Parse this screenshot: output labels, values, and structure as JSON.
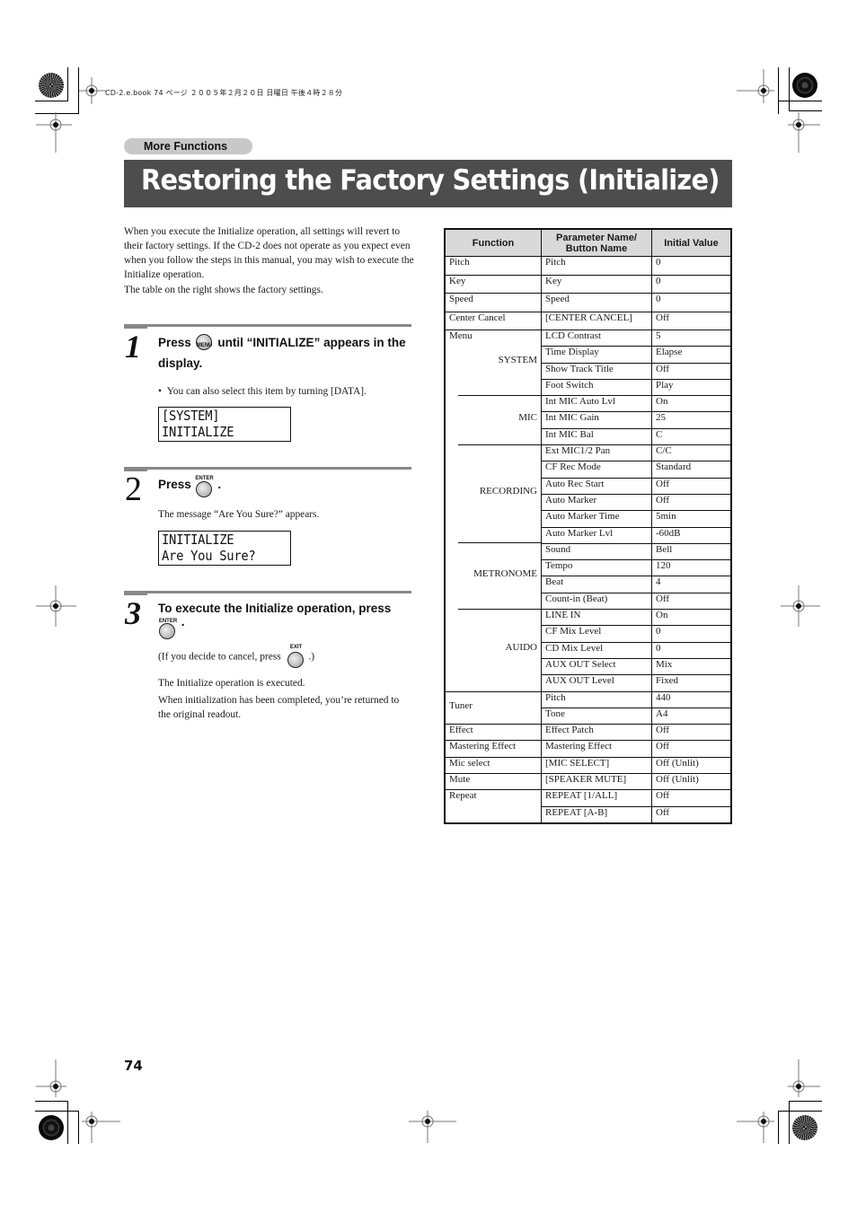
{
  "print_header": "CD-2.e.book  74 ページ  ２００５年２月２０日  日曜日  午後４時２８分",
  "section_label": "More Functions",
  "page_title": "Restoring the Factory Settings (Initialize)",
  "intro": {
    "paragraph1": "When you execute the Initialize operation, all settings will revert to their factory settings. If the CD-2 does not operate as you expect even when you follow the steps in this manual, you may wish to execute the Initialize operation.",
    "paragraph2": "The table on the right shows the factory settings."
  },
  "steps": [
    {
      "number": "1",
      "heading_before": "Press",
      "button_label": "MENU",
      "heading_after": "until “INITIALIZE” appears in the display.",
      "bullet": "You can also select this item by turning [DATA].",
      "lcd": [
        "[SYSTEM]",
        "INITIALIZE"
      ]
    },
    {
      "number": "2",
      "heading_before": "Press",
      "button_label": "ENTER",
      "heading_after": ".",
      "text": "The message “Are You Sure?” appears.",
      "lcd": [
        "INITIALIZE",
        "Are You Sure?"
      ]
    },
    {
      "number": "3",
      "heading": "To execute the Initialize operation, press",
      "button_label": "ENTER",
      "heading_after": ".",
      "cancel_before": "(If you decide to cancel, press",
      "cancel_button_label": "EXIT",
      "cancel_after": ".)",
      "text1": "The Initialize operation is executed.",
      "text2": "When initialization has been completed, you’re returned to the original readout."
    }
  ],
  "table": {
    "headers": [
      "Function",
      "Parameter Name/ Button Name",
      "Initial Value"
    ],
    "rows": [
      {
        "function": "Pitch",
        "param": "Pitch",
        "value": "0"
      },
      {
        "function": "Key",
        "param": "Key",
        "value": "0"
      },
      {
        "function": "Speed",
        "param": "Speed",
        "value": "0"
      },
      {
        "function": "Center Cancel",
        "param": "[CENTER CANCEL]",
        "value": "Off"
      },
      {
        "function": "Menu",
        "group": "SYSTEM",
        "param": "LCD Contrast",
        "value": "5"
      },
      {
        "param": "Time Display",
        "value": "Elapse"
      },
      {
        "param": "Show Track Title",
        "value": "Off"
      },
      {
        "param": "Foot Switch",
        "value": "Play"
      },
      {
        "group": "MIC",
        "param": "Int MIC Auto Lvl",
        "value": "On"
      },
      {
        "param": "Int MIC Gain",
        "value": "25"
      },
      {
        "param": "Int MIC Bal",
        "value": "C"
      },
      {
        "group": "RECORDING",
        "param": "Ext MIC1/2 Pan",
        "value": "C/C"
      },
      {
        "param": "CF Rec Mode",
        "value": "Standard"
      },
      {
        "param": "Auto Rec Start",
        "value": "Off"
      },
      {
        "param": "Auto Marker",
        "value": "Off"
      },
      {
        "param": "Auto Marker Time",
        "value": "5min"
      },
      {
        "param": "Auto Marker Lvl",
        "value": "-60dB"
      },
      {
        "group": "METRONOME",
        "param": "Sound",
        "value": "Bell"
      },
      {
        "param": "Tempo",
        "value": "120"
      },
      {
        "param": "Beat",
        "value": "4"
      },
      {
        "param": "Count-in (Beat)",
        "value": "Off"
      },
      {
        "group": "AUIDO",
        "param": "LINE IN",
        "value": "On"
      },
      {
        "param": "CF Mix Level",
        "value": "0"
      },
      {
        "param": "CD Mix Level",
        "value": "0"
      },
      {
        "param": "AUX OUT Select",
        "value": "Mix"
      },
      {
        "param": "AUX OUT Level",
        "value": "Fixed"
      },
      {
        "function": "Tuner",
        "param": "Pitch",
        "value": "440"
      },
      {
        "param": "Tone",
        "value": "A4"
      },
      {
        "function": "Effect",
        "param": "Effect Patch",
        "value": "Off"
      },
      {
        "function": "Mastering Effect",
        "param": "Mastering Effect",
        "value": "Off"
      },
      {
        "function": "Mic select",
        "param": "[MIC SELECT]",
        "value": "Off (Unlit)"
      },
      {
        "function": "Mute",
        "param": "[SPEAKER MUTE]",
        "value": "Off (Unlit)"
      },
      {
        "function": "Repeat",
        "param": "REPEAT [1/ALL]",
        "value": "Off"
      },
      {
        "param": "REPEAT [A-B]",
        "value": "Off"
      }
    ]
  },
  "page_number": "74"
}
